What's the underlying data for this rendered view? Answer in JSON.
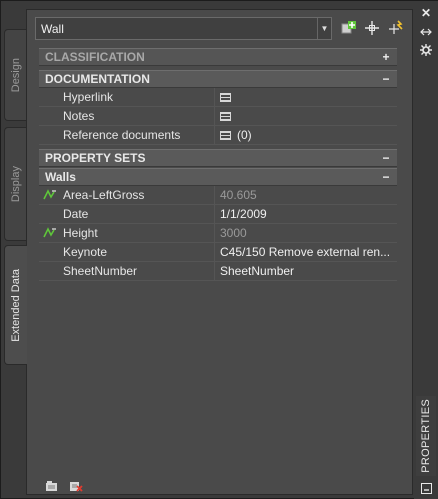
{
  "tabs": {
    "design": "Design",
    "display": "Display",
    "extended": "Extended Data"
  },
  "palette_title": "PROPERTIES",
  "style_selector": {
    "value": "Wall"
  },
  "sections": {
    "classification": {
      "title": "CLASSIFICATION",
      "toggle": "+"
    },
    "documentation": {
      "title": "DOCUMENTATION",
      "toggle": "−"
    },
    "property_sets": {
      "title": "PROPERTY SETS",
      "toggle": "−"
    },
    "walls": {
      "title": "Walls",
      "toggle": "−"
    }
  },
  "documentation_rows": [
    {
      "name": "Hyperlink",
      "value": ""
    },
    {
      "name": "Notes",
      "value": ""
    },
    {
      "name": "Reference documents",
      "value": "(0)"
    }
  ],
  "walls_rows": [
    {
      "name": "Area-LeftGross",
      "value": "40.605",
      "readonly": true,
      "icon": "formula-icon"
    },
    {
      "name": "Date",
      "value": "1/1/2009",
      "readonly": false
    },
    {
      "name": "Height",
      "value": "3000",
      "readonly": true,
      "icon": "formula-icon"
    },
    {
      "name": "Keynote",
      "value": "C45/150 Remove external ren...",
      "readonly": false
    },
    {
      "name": "SheetNumber",
      "value": "SheetNumber",
      "readonly": false
    }
  ],
  "colors": {
    "accent_green": "#5fc63a",
    "header_bg": "#5a5a5a",
    "panel_bg": "#4a4a4a"
  }
}
